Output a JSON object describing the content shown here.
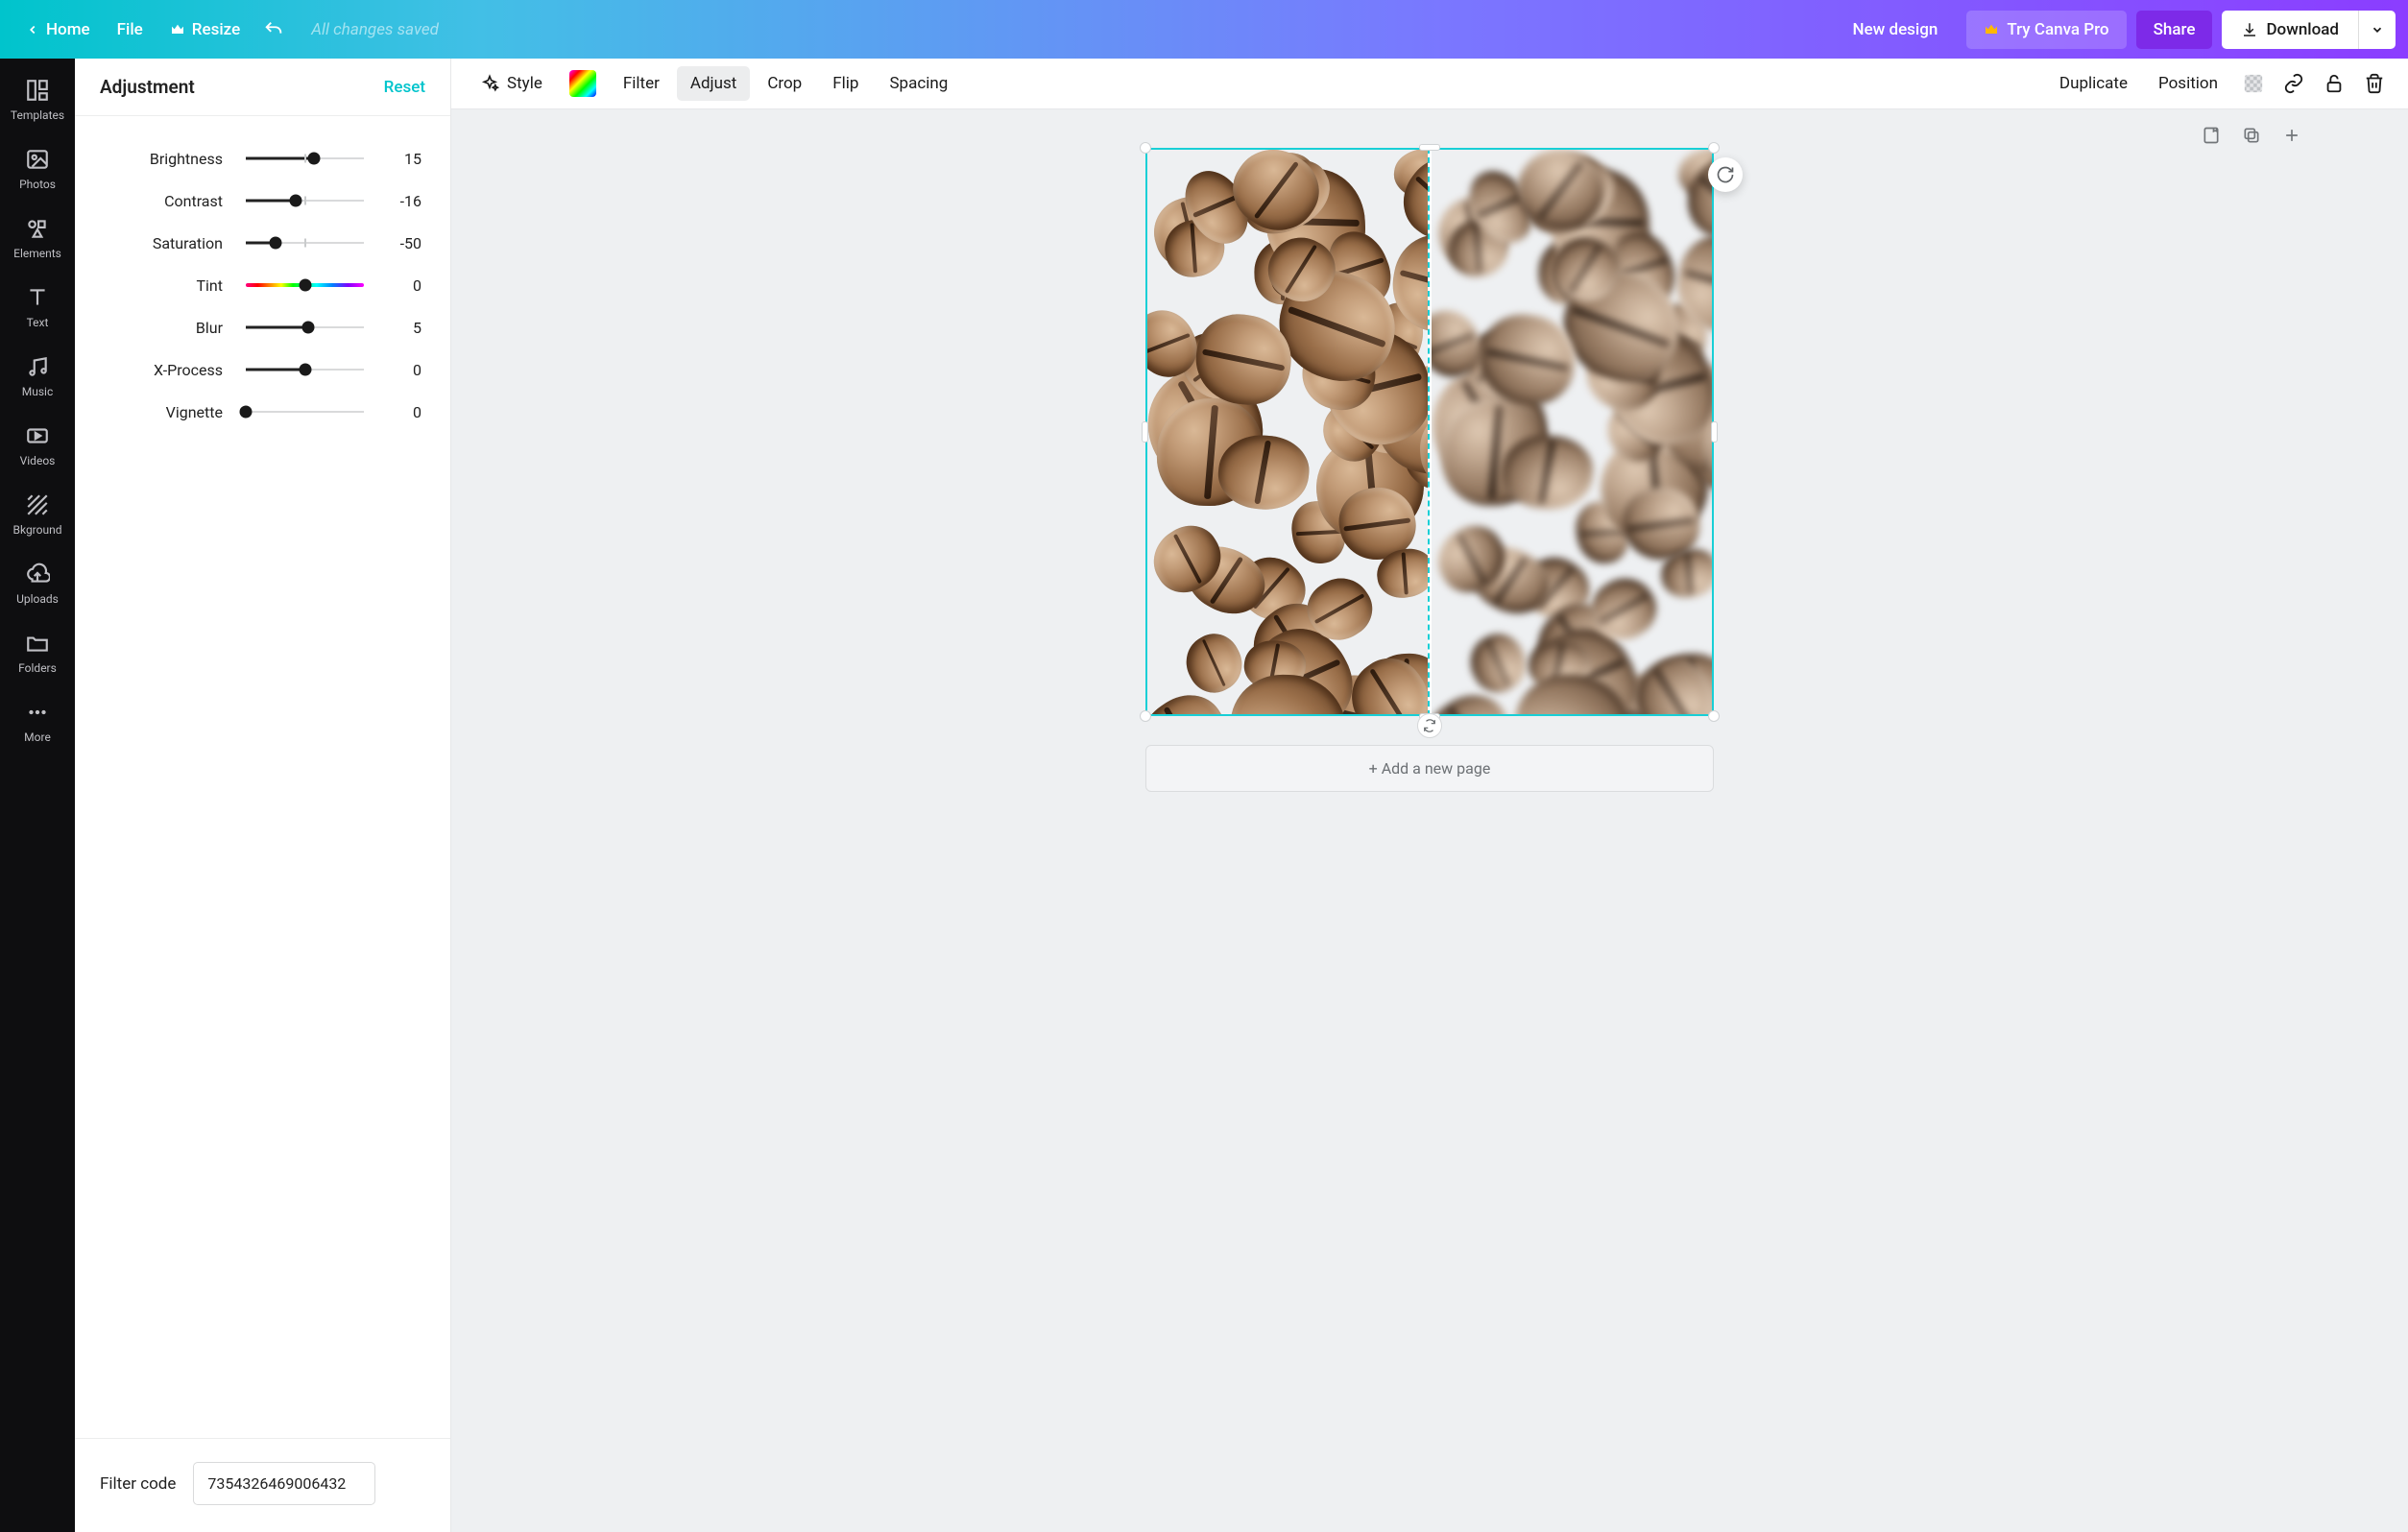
{
  "topbar": {
    "home": "Home",
    "file": "File",
    "resize": "Resize",
    "saved_status": "All changes saved",
    "new_design": "New design",
    "try_pro": "Try Canva Pro",
    "share": "Share",
    "download": "Download"
  },
  "leftnav": {
    "items": [
      {
        "label": "Templates"
      },
      {
        "label": "Photos"
      },
      {
        "label": "Elements"
      },
      {
        "label": "Text"
      },
      {
        "label": "Music"
      },
      {
        "label": "Videos"
      },
      {
        "label": "Bkground"
      },
      {
        "label": "Uploads"
      },
      {
        "label": "Folders"
      },
      {
        "label": "More"
      }
    ]
  },
  "adjust": {
    "title": "Adjustment",
    "reset": "Reset",
    "rows": [
      {
        "label": "Brightness",
        "value": 15,
        "min": -100,
        "max": 100,
        "center_tick": true
      },
      {
        "label": "Contrast",
        "value": -16,
        "min": -100,
        "max": 100,
        "center_tick": true
      },
      {
        "label": "Saturation",
        "value": -50,
        "min": -100,
        "max": 100,
        "center_tick": true
      },
      {
        "label": "Tint",
        "value": 0,
        "min": -100,
        "max": 100,
        "tint": true
      },
      {
        "label": "Blur",
        "value": 5,
        "min": -100,
        "max": 100,
        "center_tick": true
      },
      {
        "label": "X-Process",
        "value": 0,
        "min": -100,
        "max": 100,
        "center_tick": true
      },
      {
        "label": "Vignette",
        "value": 0,
        "min": 0,
        "max": 100
      }
    ],
    "filter_code_label": "Filter code",
    "filter_code": "7354326469006432"
  },
  "contextbar": {
    "style": "Style",
    "filter": "Filter",
    "adjust": "Adjust",
    "crop": "Crop",
    "flip": "Flip",
    "spacing": "Spacing",
    "duplicate": "Duplicate",
    "position": "Position"
  },
  "canvas": {
    "add_page": "+ Add a new page"
  }
}
